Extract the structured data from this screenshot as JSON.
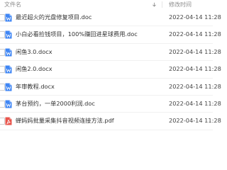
{
  "header": {
    "name_label": "文件名",
    "time_label": "修改时间"
  },
  "colors": {
    "doc_icon": "#3f86f4",
    "pdf_icon": "#e8544b",
    "header_text": "#8c8c8c"
  },
  "files": [
    {
      "name": "最近超火的光盘修复项目.doc",
      "modified": "2022-04-14 11:28",
      "icon": "doc-icon"
    },
    {
      "name": "小白必看捡钱项目，100%赚回进星球费用.doc",
      "modified": "2022-04-14 11:28",
      "icon": "doc-icon"
    },
    {
      "name": "闲鱼3.0.docx",
      "modified": "2022-04-14 11:28",
      "icon": "doc-icon"
    },
    {
      "name": "闲鱼2.0.docx",
      "modified": "2022-04-14 11:28",
      "icon": "doc-icon"
    },
    {
      "name": "年审教程.docx",
      "modified": "2022-04-14 11:28",
      "icon": "doc-icon"
    },
    {
      "name": "茅台预约，一单2000利润.doc",
      "modified": "2022-04-14 11:28",
      "icon": "doc-icon"
    },
    {
      "name": "蝉妈妈批量采集抖音视频连接方法.pdf",
      "modified": "2022-04-14 11:28",
      "icon": "pdf-icon"
    }
  ]
}
